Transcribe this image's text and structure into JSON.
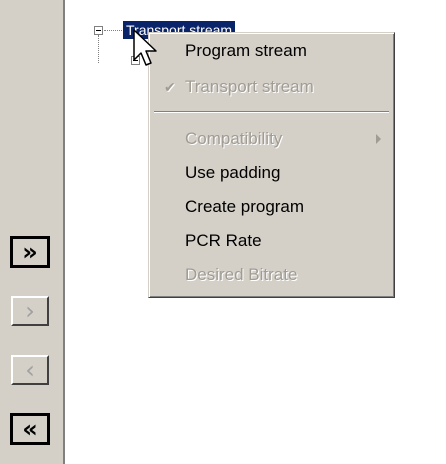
{
  "tree": {
    "root_label": "Transport stream"
  },
  "context_menu": {
    "items": [
      {
        "label": "Program stream",
        "enabled": true
      },
      {
        "label": "Transport stream",
        "enabled": false,
        "checked": true
      },
      {
        "label": "Compatibility",
        "enabled": false,
        "submenu": true
      },
      {
        "label": "Use padding",
        "enabled": true
      },
      {
        "label": "Create program",
        "enabled": true
      },
      {
        "label": "PCR Rate",
        "enabled": true
      },
      {
        "label": "Desired Bitrate",
        "enabled": false
      }
    ]
  },
  "side_buttons": [
    {
      "icon": "double-chevron-right-icon",
      "glyph": "»",
      "enabled": true
    },
    {
      "icon": "chevron-right-icon",
      "glyph": "›",
      "enabled": false
    },
    {
      "icon": "chevron-left-icon",
      "glyph": "‹",
      "enabled": false
    },
    {
      "icon": "double-chevron-left-icon",
      "glyph": "«",
      "enabled": true
    }
  ],
  "colors": {
    "selection": "#0a246a",
    "face": "#d4d0c8",
    "disabled_text": "#a09c94"
  }
}
